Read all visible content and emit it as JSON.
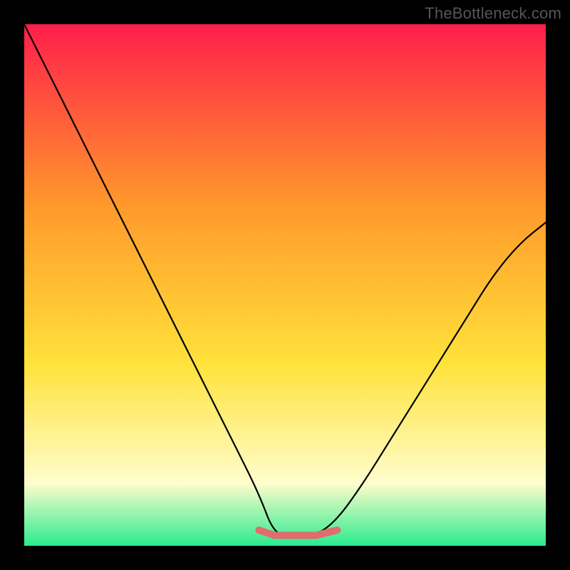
{
  "watermark": "TheBottleneck.com",
  "colors": {
    "bg": "#000000",
    "grad_top": "#FF1E4B",
    "grad_mid1": "#FF9A2B",
    "grad_mid2": "#FFE23A",
    "grad_low": "#FFFDCC",
    "grad_bottom": "#2AEB8E",
    "curve": "#000000",
    "flat_marker": "#E06D6D"
  },
  "chart_data": {
    "type": "line",
    "title": "",
    "xlabel": "",
    "ylabel": "",
    "xlim": [
      0,
      1
    ],
    "ylim": [
      0,
      1
    ],
    "series": [
      {
        "name": "bottleneck-curve",
        "x": [
          0.0,
          0.05,
          0.1,
          0.15,
          0.2,
          0.25,
          0.3,
          0.35,
          0.4,
          0.45,
          0.48,
          0.52,
          0.56,
          0.6,
          0.65,
          0.7,
          0.75,
          0.8,
          0.85,
          0.9,
          0.95,
          1.0
        ],
        "values": [
          1.0,
          0.9,
          0.8,
          0.7,
          0.6,
          0.5,
          0.4,
          0.3,
          0.2,
          0.1,
          0.02,
          0.02,
          0.02,
          0.05,
          0.12,
          0.2,
          0.28,
          0.36,
          0.44,
          0.52,
          0.58,
          0.62
        ]
      },
      {
        "name": "flat-bottom-marker",
        "x": [
          0.45,
          0.48,
          0.52,
          0.56,
          0.6
        ],
        "values": [
          0.03,
          0.02,
          0.02,
          0.02,
          0.03
        ]
      }
    ],
    "gradient_stops": [
      {
        "pos": 0.0,
        "color": "#FF1E4B"
      },
      {
        "pos": 0.35,
        "color": "#FF9A2B"
      },
      {
        "pos": 0.65,
        "color": "#FFE23A"
      },
      {
        "pos": 0.88,
        "color": "#FFFDCC"
      },
      {
        "pos": 1.0,
        "color": "#2AEB8E"
      }
    ]
  }
}
